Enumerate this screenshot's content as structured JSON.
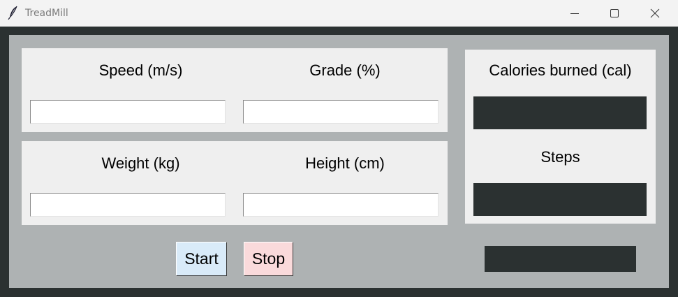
{
  "window": {
    "title": "TreadMill",
    "app_icon": "feather-icon",
    "controls": [
      "minimize-icon",
      "maximize-icon",
      "close-icon"
    ]
  },
  "inputs_panel_1": {
    "speed": {
      "label": "Speed (m/s)",
      "value": ""
    },
    "grade": {
      "label": "Grade (%)",
      "value": ""
    }
  },
  "inputs_panel_2": {
    "weight": {
      "label": "Weight (kg)",
      "value": ""
    },
    "height": {
      "label": "Height (cm)",
      "value": ""
    }
  },
  "results": {
    "calories": {
      "label": "Calories burned (cal)",
      "value": ""
    },
    "steps": {
      "label": "Steps",
      "value": ""
    },
    "status": {
      "value": ""
    }
  },
  "buttons": {
    "start": {
      "label": "Start",
      "color": "#d9ebf9"
    },
    "stop": {
      "label": "Stop",
      "color": "#fadadb"
    }
  },
  "colors": {
    "frame": "#2b3131",
    "background": "#aeb2b3",
    "panel": "#efefef",
    "output": "#2b3131"
  }
}
